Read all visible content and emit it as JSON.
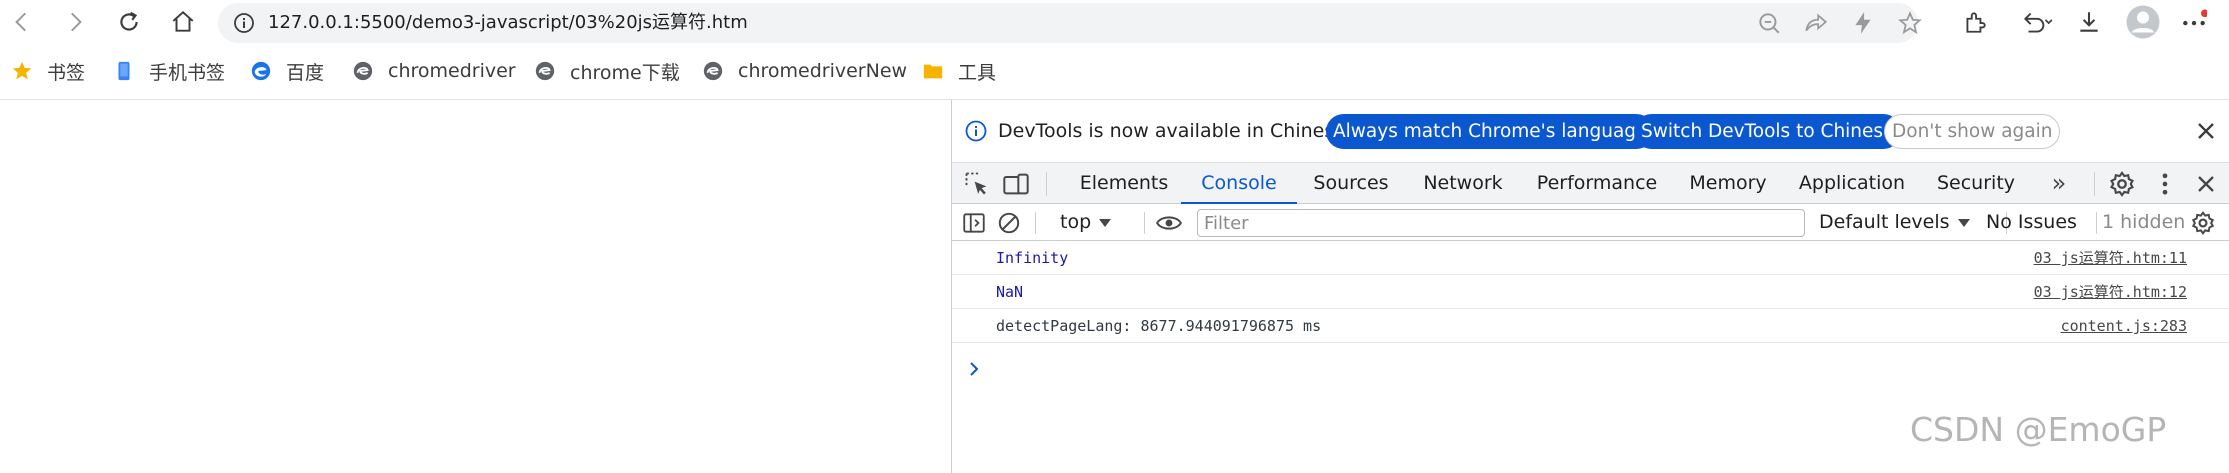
{
  "browser": {
    "url": "127.0.0.1:5500/demo3-javascript/03%20js运算符.htm",
    "icons": [
      "back-icon",
      "forward-icon",
      "reload-icon",
      "home-icon",
      "info-icon",
      "zoom-out-icon",
      "share-icon",
      "bolt-icon",
      "star-icon",
      "extensions-icon",
      "history-back-icon",
      "download-icon",
      "profile-icon",
      "more-icon"
    ],
    "colors": {
      "accent": "#0b57d0",
      "notification_dot": "#e53935",
      "folder": "#f5b400"
    }
  },
  "bookmarks": [
    {
      "label": "书签",
      "icon": "star-icon"
    },
    {
      "label": "手机书签",
      "icon": "phone-icon"
    },
    {
      "label": "百度",
      "icon": "edge-icon"
    },
    {
      "label": "chromedriver",
      "icon": "globe-icon"
    },
    {
      "label": "chrome下载",
      "icon": "globe-icon"
    },
    {
      "label": "chromedriverNew",
      "icon": "globe-icon"
    },
    {
      "label": "工具",
      "icon": "folder-icon"
    }
  ],
  "devtools": {
    "infobar": {
      "message": "DevTools is now available in Chinese!",
      "match_label": "Always match Chrome's language",
      "switch_label": "Switch DevTools to Chinese",
      "dismiss_label": "Don't show again"
    },
    "tabs": [
      {
        "label": "Elements",
        "active": false
      },
      {
        "label": "Console",
        "active": true
      },
      {
        "label": "Sources",
        "active": false
      },
      {
        "label": "Network",
        "active": false
      },
      {
        "label": "Performance",
        "active": false
      },
      {
        "label": "Memory",
        "active": false
      },
      {
        "label": "Application",
        "active": false
      },
      {
        "label": "Security",
        "active": false
      }
    ],
    "more_tabs": "»",
    "console_toolbar": {
      "context": "top",
      "filter_placeholder": "Filter",
      "levels": "Default levels",
      "issues": "No Issues",
      "hidden": "1 hidden"
    },
    "logs": [
      {
        "message": "Infinity",
        "source": "03 js运算符.htm:11",
        "kind": "num"
      },
      {
        "message": "NaN",
        "source": "03 js运算符.htm:12",
        "kind": "num"
      },
      {
        "message": "detectPageLang: 8677.944091796875 ms",
        "source": "content.js:283",
        "kind": "plain"
      }
    ]
  },
  "watermark": "CSDN @EmoGP"
}
